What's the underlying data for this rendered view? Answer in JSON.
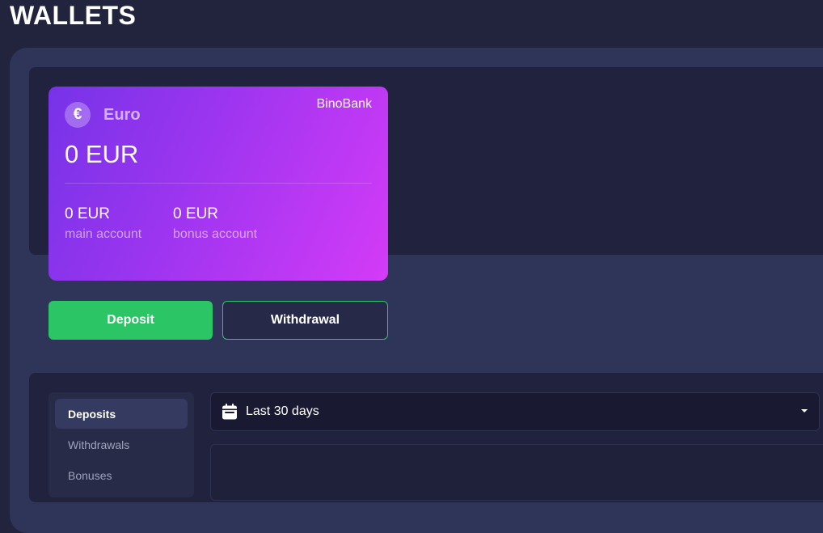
{
  "page": {
    "title": "WALLETS"
  },
  "wallet": {
    "currency_icon": "€",
    "currency_icon_name": "euro-icon",
    "currency_name": "Euro",
    "bank": "BinoBank",
    "total_balance": "0 EUR",
    "main_amount": "0 EUR",
    "main_label": "main account",
    "bonus_amount": "0 EUR",
    "bonus_label": "bonus account"
  },
  "actions": {
    "deposit_label": "Deposit",
    "withdrawal_label": "Withdrawal"
  },
  "history": {
    "tabs": [
      {
        "label": "Deposits",
        "active": true
      },
      {
        "label": "Withdrawals",
        "active": false
      },
      {
        "label": "Bonuses",
        "active": false
      }
    ],
    "date_filter": {
      "icon": "calendar-icon",
      "selected": "Last 30 days"
    }
  },
  "colors": {
    "background": "#22233d",
    "card_gradient_start": "#7633e8",
    "card_gradient_end": "#d43bf7",
    "accent_green": "#2bc566"
  }
}
